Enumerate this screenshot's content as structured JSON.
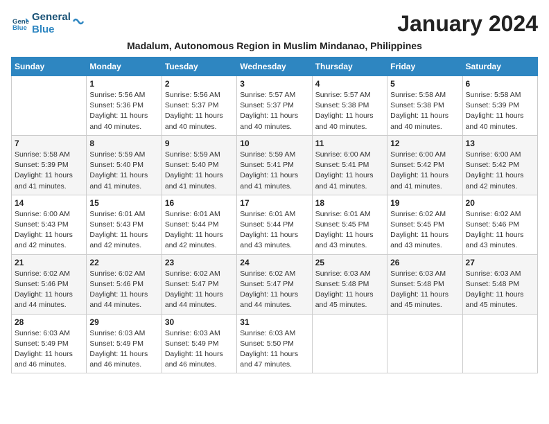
{
  "header": {
    "logo_line1": "General",
    "logo_line2": "Blue",
    "month_title": "January 2024",
    "location": "Madalum, Autonomous Region in Muslim Mindanao, Philippines"
  },
  "days_of_week": [
    "Sunday",
    "Monday",
    "Tuesday",
    "Wednesday",
    "Thursday",
    "Friday",
    "Saturday"
  ],
  "weeks": [
    [
      {
        "num": "",
        "info": ""
      },
      {
        "num": "1",
        "info": "Sunrise: 5:56 AM\nSunset: 5:36 PM\nDaylight: 11 hours\nand 40 minutes."
      },
      {
        "num": "2",
        "info": "Sunrise: 5:56 AM\nSunset: 5:37 PM\nDaylight: 11 hours\nand 40 minutes."
      },
      {
        "num": "3",
        "info": "Sunrise: 5:57 AM\nSunset: 5:37 PM\nDaylight: 11 hours\nand 40 minutes."
      },
      {
        "num": "4",
        "info": "Sunrise: 5:57 AM\nSunset: 5:38 PM\nDaylight: 11 hours\nand 40 minutes."
      },
      {
        "num": "5",
        "info": "Sunrise: 5:58 AM\nSunset: 5:38 PM\nDaylight: 11 hours\nand 40 minutes."
      },
      {
        "num": "6",
        "info": "Sunrise: 5:58 AM\nSunset: 5:39 PM\nDaylight: 11 hours\nand 40 minutes."
      }
    ],
    [
      {
        "num": "7",
        "info": "Sunrise: 5:58 AM\nSunset: 5:39 PM\nDaylight: 11 hours\nand 41 minutes."
      },
      {
        "num": "8",
        "info": "Sunrise: 5:59 AM\nSunset: 5:40 PM\nDaylight: 11 hours\nand 41 minutes."
      },
      {
        "num": "9",
        "info": "Sunrise: 5:59 AM\nSunset: 5:40 PM\nDaylight: 11 hours\nand 41 minutes."
      },
      {
        "num": "10",
        "info": "Sunrise: 5:59 AM\nSunset: 5:41 PM\nDaylight: 11 hours\nand 41 minutes."
      },
      {
        "num": "11",
        "info": "Sunrise: 6:00 AM\nSunset: 5:41 PM\nDaylight: 11 hours\nand 41 minutes."
      },
      {
        "num": "12",
        "info": "Sunrise: 6:00 AM\nSunset: 5:42 PM\nDaylight: 11 hours\nand 41 minutes."
      },
      {
        "num": "13",
        "info": "Sunrise: 6:00 AM\nSunset: 5:42 PM\nDaylight: 11 hours\nand 42 minutes."
      }
    ],
    [
      {
        "num": "14",
        "info": "Sunrise: 6:00 AM\nSunset: 5:43 PM\nDaylight: 11 hours\nand 42 minutes."
      },
      {
        "num": "15",
        "info": "Sunrise: 6:01 AM\nSunset: 5:43 PM\nDaylight: 11 hours\nand 42 minutes."
      },
      {
        "num": "16",
        "info": "Sunrise: 6:01 AM\nSunset: 5:44 PM\nDaylight: 11 hours\nand 42 minutes."
      },
      {
        "num": "17",
        "info": "Sunrise: 6:01 AM\nSunset: 5:44 PM\nDaylight: 11 hours\nand 43 minutes."
      },
      {
        "num": "18",
        "info": "Sunrise: 6:01 AM\nSunset: 5:45 PM\nDaylight: 11 hours\nand 43 minutes."
      },
      {
        "num": "19",
        "info": "Sunrise: 6:02 AM\nSunset: 5:45 PM\nDaylight: 11 hours\nand 43 minutes."
      },
      {
        "num": "20",
        "info": "Sunrise: 6:02 AM\nSunset: 5:46 PM\nDaylight: 11 hours\nand 43 minutes."
      }
    ],
    [
      {
        "num": "21",
        "info": "Sunrise: 6:02 AM\nSunset: 5:46 PM\nDaylight: 11 hours\nand 44 minutes."
      },
      {
        "num": "22",
        "info": "Sunrise: 6:02 AM\nSunset: 5:46 PM\nDaylight: 11 hours\nand 44 minutes."
      },
      {
        "num": "23",
        "info": "Sunrise: 6:02 AM\nSunset: 5:47 PM\nDaylight: 11 hours\nand 44 minutes."
      },
      {
        "num": "24",
        "info": "Sunrise: 6:02 AM\nSunset: 5:47 PM\nDaylight: 11 hours\nand 44 minutes."
      },
      {
        "num": "25",
        "info": "Sunrise: 6:03 AM\nSunset: 5:48 PM\nDaylight: 11 hours\nand 45 minutes."
      },
      {
        "num": "26",
        "info": "Sunrise: 6:03 AM\nSunset: 5:48 PM\nDaylight: 11 hours\nand 45 minutes."
      },
      {
        "num": "27",
        "info": "Sunrise: 6:03 AM\nSunset: 5:48 PM\nDaylight: 11 hours\nand 45 minutes."
      }
    ],
    [
      {
        "num": "28",
        "info": "Sunrise: 6:03 AM\nSunset: 5:49 PM\nDaylight: 11 hours\nand 46 minutes."
      },
      {
        "num": "29",
        "info": "Sunrise: 6:03 AM\nSunset: 5:49 PM\nDaylight: 11 hours\nand 46 minutes."
      },
      {
        "num": "30",
        "info": "Sunrise: 6:03 AM\nSunset: 5:49 PM\nDaylight: 11 hours\nand 46 minutes."
      },
      {
        "num": "31",
        "info": "Sunrise: 6:03 AM\nSunset: 5:50 PM\nDaylight: 11 hours\nand 47 minutes."
      },
      {
        "num": "",
        "info": ""
      },
      {
        "num": "",
        "info": ""
      },
      {
        "num": "",
        "info": ""
      }
    ]
  ]
}
